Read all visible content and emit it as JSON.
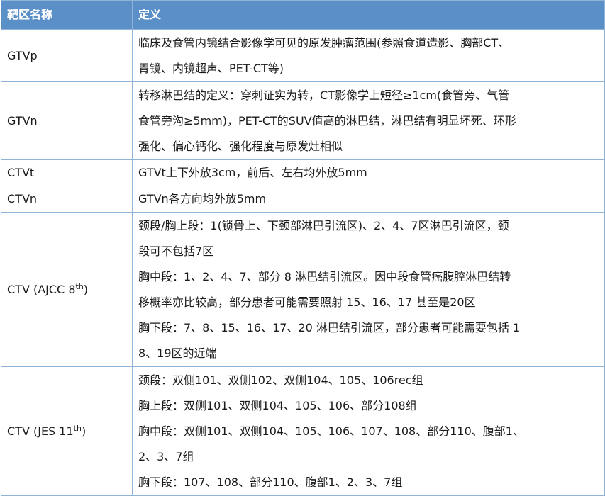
{
  "headers": {
    "col1": "靶区名称",
    "col2": "定义"
  },
  "rows": {
    "gtvp": {
      "term": "GTVp",
      "lines": [
        "临床及食管内镜结合影像学可见的原发肿瘤范围(参照食道造影、胸部CT、",
        "胃镜、内镜超声、PET-CT等)"
      ]
    },
    "gtvn": {
      "term": "GTVn",
      "lines": [
        "转移淋巴结的定义：穿刺证实为转，CT影像学上短径≥1cm(食管旁、气管",
        "食管旁沟≥5mm)，PET-CT的SUV值高的淋巴结，淋巴结有明显坏死、环形",
        "强化、偏心钙化、强化程度与原发灶相似"
      ]
    },
    "ctvt": {
      "term": "CTVt",
      "lines": [
        "GTVt上下外放3cm，前后、左右均外放5mm"
      ]
    },
    "ctvn": {
      "term": "CTVn",
      "lines": [
        "GTVn各方向均外放5mm"
      ]
    },
    "ctv_ajcc": {
      "term_prefix": "CTV (AJCC 8",
      "term_sup": "th",
      "term_suffix": ")",
      "lines": [
        "颈段/胸上段：1(锁骨上、下颈部淋巴引流区)、2、4、7区淋巴引流区，颈",
        "段可不包括7区",
        "胸中段：1、2、4、7、部分 8 淋巴结引流区。因中段食管癌腹腔淋巴结转",
        "移概率亦比较高，部分患者可能需要照射 15、16、17 甚至是20区",
        "胸下段：7、8、15、16、17、20 淋巴结引流区，部分患者可能需要包括 1",
        "8、19区的近端"
      ]
    },
    "ctv_jes": {
      "term_prefix": "CTV (JES 11",
      "term_sup": "th",
      "term_suffix": ")",
      "lines": [
        "颈段：双侧101、双侧102、双侧104、105、106rec组",
        "胸上段：双侧101、双侧104、105、106、部分108组",
        "胸中段：双侧101、双侧104、105、106、107、108、部分110、腹部1、",
        "2、3、7组",
        "胸下段：107、108、部分110、腹部1、2、3、7组"
      ]
    }
  }
}
